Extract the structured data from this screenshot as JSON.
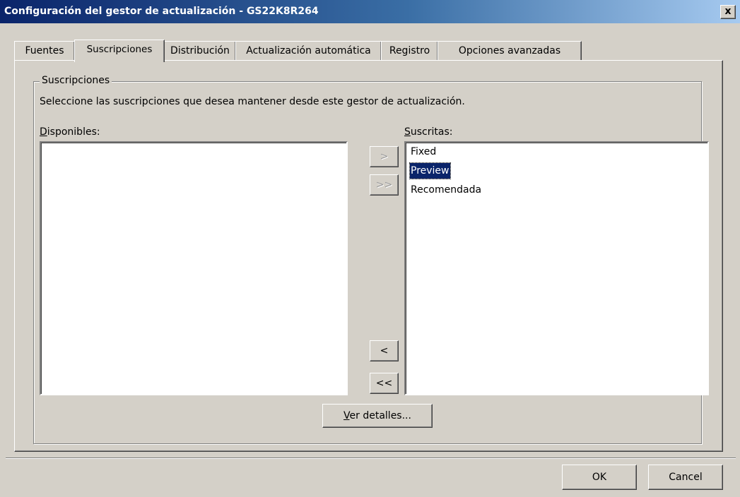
{
  "window": {
    "title": "Configuración del gestor de actualización - GS22K8R264",
    "close_glyph": "x"
  },
  "tabs": [
    {
      "label": "Fuentes",
      "active": false
    },
    {
      "label": "Suscripciones",
      "active": true
    },
    {
      "label": "Distribución",
      "active": false
    },
    {
      "label": "Actualización automática",
      "active": false
    },
    {
      "label": "Registro",
      "active": false
    },
    {
      "label": "Opciones avanzadas",
      "active": false
    }
  ],
  "subscriptions": {
    "group_title": "Suscripciones",
    "instructions": "Seleccione las suscripciones que desea mantener desde este gestor de actualización.",
    "available": {
      "label_hotkey": "D",
      "label_rest": "isponibles:",
      "items": []
    },
    "subscribed": {
      "label_hotkey": "S",
      "label_rest": "uscritas:",
      "items": [
        {
          "label": "Fixed",
          "selected": false
        },
        {
          "label": "Preview",
          "selected": true
        },
        {
          "label": "Recomendada",
          "selected": false
        }
      ]
    },
    "buttons": {
      "add": ">",
      "add_all": ">>",
      "remove": "<",
      "remove_all": "<<"
    },
    "details_button": {
      "hotkey": "V",
      "rest": "er detalles..."
    }
  },
  "footer": {
    "ok": "OK",
    "cancel": "Cancel"
  }
}
